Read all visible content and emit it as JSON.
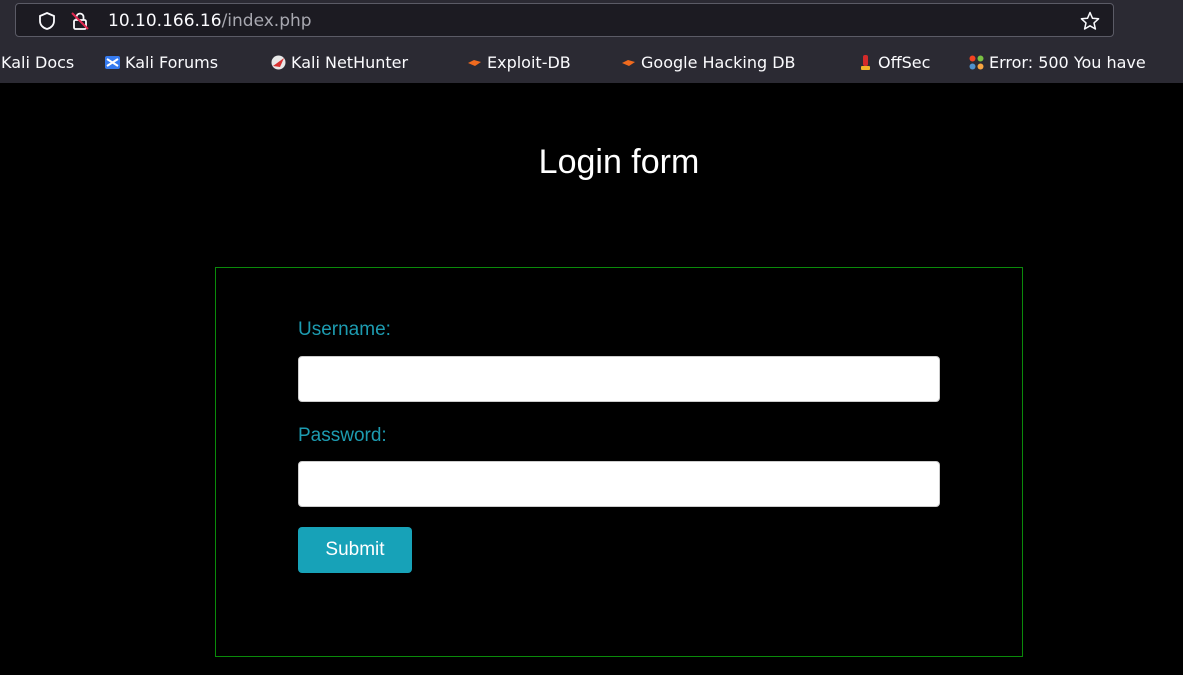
{
  "browser": {
    "url_host": "10.10.166.16",
    "url_path": "/index.php",
    "bookmarks": [
      {
        "label": "Kali Docs",
        "icon": "kali-docs-icon"
      },
      {
        "label": "Kali Forums",
        "icon": "kali-forums-icon"
      },
      {
        "label": "Kali NetHunter",
        "icon": "kali-nethunter-icon"
      },
      {
        "label": "Exploit-DB",
        "icon": "exploit-db-icon"
      },
      {
        "label": "Google Hacking DB",
        "icon": "google-hacking-db-icon"
      },
      {
        "label": "OffSec",
        "icon": "offsec-icon"
      },
      {
        "label": "Error: 500 You have",
        "icon": "joomla-icon"
      }
    ]
  },
  "page": {
    "title": "Login form",
    "username_label": "Username:",
    "username_value": "",
    "password_label": "Password:",
    "password_value": "",
    "submit_label": "Submit"
  },
  "colors": {
    "background": "#000000",
    "label": "#1d9bb0",
    "button": "#17a2b8",
    "box_border": "#0a8a0a"
  }
}
